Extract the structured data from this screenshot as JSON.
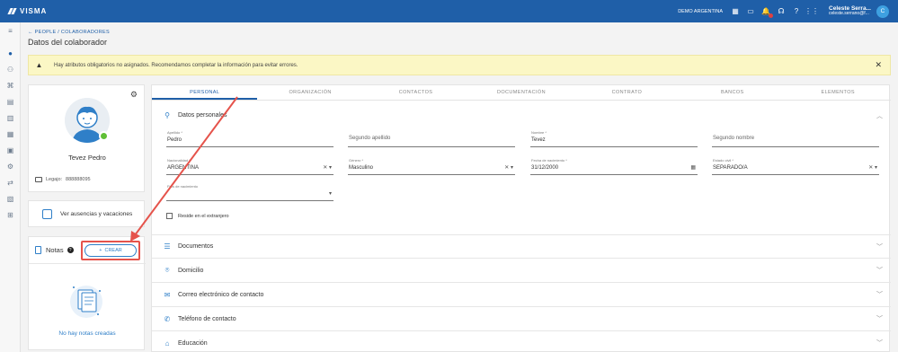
{
  "topbar": {
    "brand": "VISMA",
    "company": "DEMO ARGENTINA",
    "user_name": "Celeste Serra...",
    "user_email": "celeste.serrano@f...",
    "avatar_initial": "C"
  },
  "header": {
    "breadcrumb": "← PEOPLE / COLABORADORES",
    "title": "Datos del colaborador"
  },
  "warning": {
    "text": "Hay atributos obligatorios no asignados. Recomendamos completar la información para evitar errores."
  },
  "profile": {
    "name": "Tevez Pedro",
    "legajo_label": "Legajo:",
    "legajo_value": "888888095",
    "status_color": "#5fbf36"
  },
  "absence": {
    "label": "Ver ausencias y vacaciones"
  },
  "notes": {
    "title": "Notas",
    "create_label": "CREAR",
    "empty_text": "No hay notas creadas"
  },
  "tabs": [
    "PERSONAL",
    "ORGANIZACIÓN",
    "CONTACTOS",
    "DOCUMENTACIÓN",
    "CONTRATO",
    "BANCOS",
    "ELEMENTOS"
  ],
  "personal": {
    "section_title": "Datos personales",
    "apellido": {
      "label": "Apellido *",
      "value": "Pedro"
    },
    "segundo_apellido": {
      "placeholder": "Segundo apellido"
    },
    "nombre": {
      "label": "Nombre *",
      "value": "Tevez"
    },
    "segundo_nombre": {
      "placeholder": "Segundo nombre"
    },
    "nacionalidad": {
      "label": "Nacionalidad *",
      "value": "ARGENTINA"
    },
    "genero": {
      "label": "Género *",
      "value": "Masculino"
    },
    "fecha_nacimiento": {
      "label": "Fecha de nacimiento *",
      "value": "31/12/2000"
    },
    "estado_civil": {
      "label": "Estado civil *",
      "value": "SEPARADO/A"
    },
    "pais_nacimiento": {
      "label": "País de nacimiento"
    },
    "reside_extranjero": "Reside en el extranjero"
  },
  "sections": [
    {
      "title": "Documentos",
      "icon": "list-icon"
    },
    {
      "title": "Domicilio",
      "icon": "location-pin-icon"
    },
    {
      "title": "Correo electrónico de contacto",
      "icon": "mail-icon"
    },
    {
      "title": "Teléfono de contacto",
      "icon": "phone-icon"
    },
    {
      "title": "Educación",
      "icon": "graduation-cap-icon"
    }
  ],
  "colors": {
    "brand": "#1f5fa8",
    "accent": "#2f7fc8",
    "highlight": "#e5534b",
    "warning_bg": "#fbf7c5"
  }
}
